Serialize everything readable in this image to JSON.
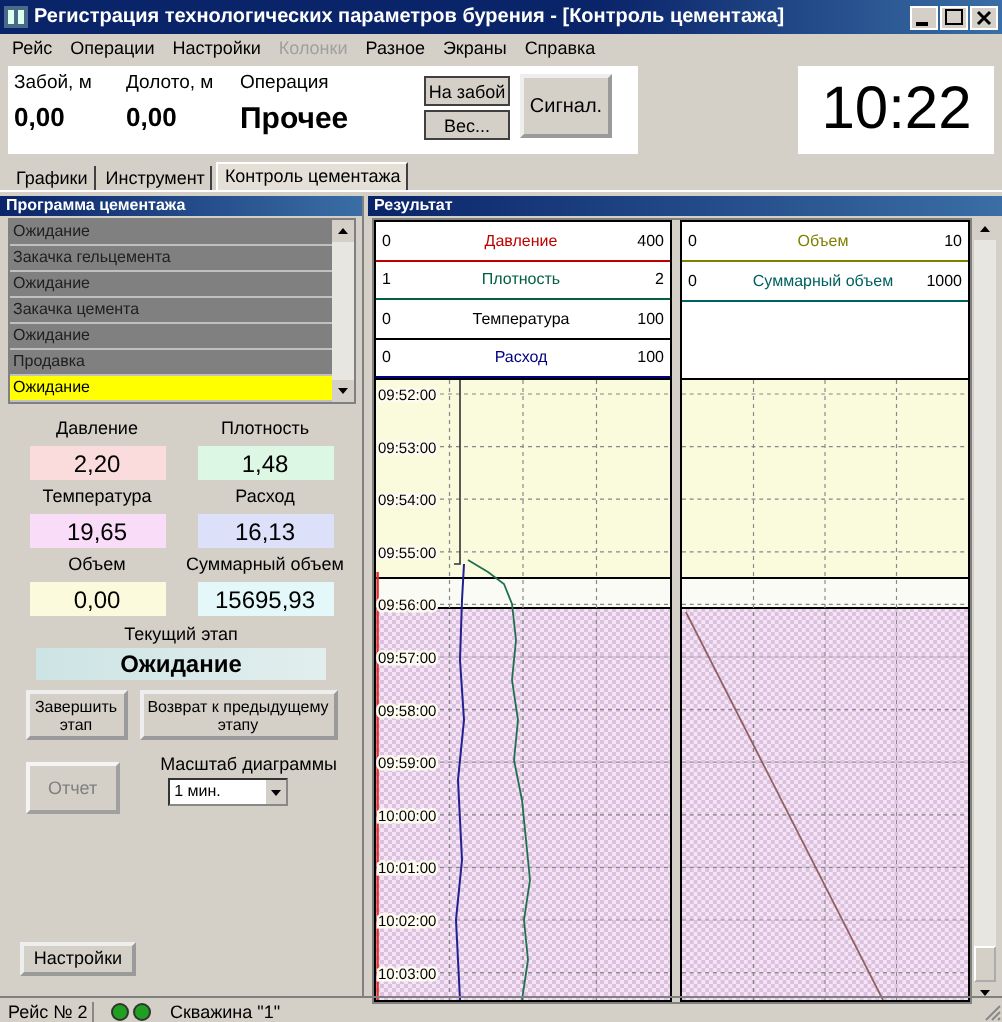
{
  "window": {
    "title": "Регистрация технологических параметров бурения - [Контроль цементажа]"
  },
  "menu": [
    {
      "label": "Рейс",
      "disabled": false
    },
    {
      "label": "Операции",
      "disabled": false
    },
    {
      "label": "Настройки",
      "disabled": false
    },
    {
      "label": "Колонки",
      "disabled": true
    },
    {
      "label": "Разное",
      "disabled": false
    },
    {
      "label": "Экраны",
      "disabled": false
    },
    {
      "label": "Справка",
      "disabled": false
    }
  ],
  "readouts": [
    {
      "label": "Забой, м",
      "value": "0,00"
    },
    {
      "label": "Долото, м",
      "value": "0,00"
    },
    {
      "label": "Операция",
      "value": "Прочее"
    }
  ],
  "top_buttons": [
    "На забой",
    "Вес..."
  ],
  "signal_button": "Сигнал.",
  "clock": "10:22",
  "tabs": [
    {
      "label": "Графики",
      "selected": false
    },
    {
      "label": "Инструмент",
      "selected": false
    },
    {
      "label": "Контроль цементажа",
      "selected": true
    }
  ],
  "program": {
    "title": "Программа цементажа",
    "steps": [
      {
        "label": "Ожидание",
        "selected": false
      },
      {
        "label": "Закачка гельцемента",
        "selected": false
      },
      {
        "label": "Ожидание",
        "selected": false
      },
      {
        "label": "Закачка цемента",
        "selected": false
      },
      {
        "label": "Ожидание",
        "selected": false
      },
      {
        "label": "Продавка",
        "selected": false
      },
      {
        "label": "Ожидание",
        "selected": true
      }
    ]
  },
  "gauges": [
    {
      "label": "Давление",
      "value": "2,20",
      "color": "#fadcdc"
    },
    {
      "label": "Плотность",
      "value": "1,48",
      "color": "#dcf8e4"
    },
    {
      "label": "Температура",
      "value": "19,65",
      "color": "#f8dcf8"
    },
    {
      "label": "Расход",
      "value": "16,13",
      "color": "#dce0f8"
    },
    {
      "label": "Объем",
      "value": "0,00",
      "color": "#fbfadc"
    },
    {
      "label": "Суммарный объем",
      "value": "15695,93",
      "color": "#e4f8fa"
    }
  ],
  "current_stage": {
    "label": "Текущий этап",
    "value": "Ожидание"
  },
  "finish_button": "Завершить этап",
  "back_button": "Возврат к предыдущему этапу",
  "report_button": {
    "label": "Отчет",
    "disabled": true
  },
  "scale": {
    "label": "Масштаб диаграммы",
    "value": "1 мин."
  },
  "settings_button": "Настройки",
  "result": {
    "title": "Результат",
    "left_scales": [
      {
        "min": "0",
        "name": "Давление",
        "max": "400",
        "color": "#c00000"
      },
      {
        "min": "1",
        "name": "Плотность",
        "max": "2",
        "color": "#006040"
      },
      {
        "min": "0",
        "name": "Температура",
        "max": "100",
        "color": "#000000"
      },
      {
        "min": "0",
        "name": "Расход",
        "max": "100",
        "color": "#000080"
      }
    ],
    "right_scales": [
      {
        "min": "0",
        "name": "Объем",
        "max": "10",
        "color": "#808000"
      },
      {
        "min": "0",
        "name": "Суммарный объем",
        "max": "1000",
        "color": "#006060"
      }
    ],
    "times": [
      "09:52:00",
      "09:53:00",
      "09:54:00",
      "09:55:00",
      "09:56:00",
      "09:57:00",
      "09:58:00",
      "09:59:00",
      "10:00:00",
      "10:01:00",
      "10:02:00",
      "10:03:00"
    ]
  },
  "status_bar": {
    "trip": "Рейс № 2",
    "well": "Скважина \"1\""
  }
}
